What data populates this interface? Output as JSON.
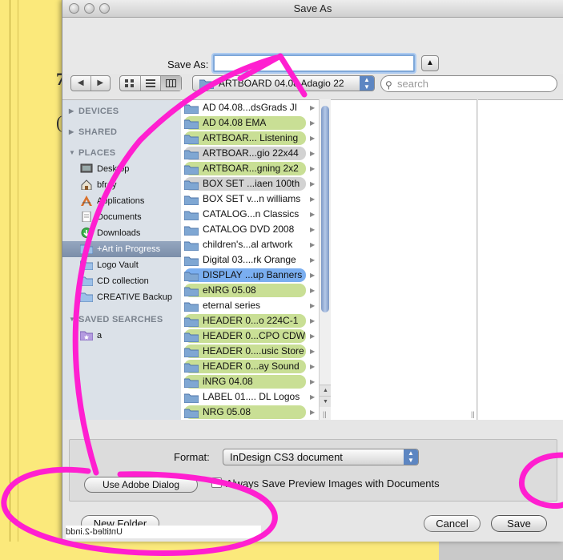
{
  "window": {
    "title": "Save As"
  },
  "save_as": {
    "label": "Save As:",
    "value": "",
    "disclosure_glyph": "▲"
  },
  "toolbar": {
    "back_glyph": "◀",
    "forward_glyph": "▶",
    "views": [
      "icon-view",
      "list-view",
      "column-view"
    ],
    "active_view": "column-view",
    "path_popup": "ARTBOARD 04.08 Adagio 22",
    "search_placeholder": "search"
  },
  "sidebar": {
    "sections": [
      {
        "label": "DEVICES",
        "expanded": false,
        "items": []
      },
      {
        "label": "SHARED",
        "expanded": false,
        "items": []
      },
      {
        "label": "PLACES",
        "expanded": true,
        "items": [
          {
            "label": "Desktop",
            "icon": "desktop-icon"
          },
          {
            "label": "bfrey",
            "icon": "home-icon"
          },
          {
            "label": "Applications",
            "icon": "applications-icon"
          },
          {
            "label": "Documents",
            "icon": "documents-icon"
          },
          {
            "label": "Downloads",
            "icon": "downloads-icon"
          },
          {
            "label": "+Art in Progress",
            "icon": "folder-icon",
            "selected": true
          },
          {
            "label": "Logo Vault",
            "icon": "folder-icon"
          },
          {
            "label": "CD collection",
            "icon": "folder-icon"
          },
          {
            "label": "CREATIVE Backup",
            "icon": "folder-icon"
          }
        ]
      },
      {
        "label": "SAVED SEARCHES",
        "expanded": true,
        "items": [
          {
            "label": "a",
            "icon": "smart-folder-icon"
          }
        ]
      }
    ]
  },
  "column1": [
    {
      "label": "AD 04.08...dsGrads JI",
      "tag": "none"
    },
    {
      "label": "AD 04.08 EMA",
      "tag": "green"
    },
    {
      "label": "ARTBOAR... Listening",
      "tag": "green"
    },
    {
      "label": "ARTBOAR...gio 22x44",
      "tag": "gray"
    },
    {
      "label": "ARTBOAR...gning 2x2",
      "tag": "green"
    },
    {
      "label": "BOX SET ...iaen 100th",
      "tag": "gray"
    },
    {
      "label": "BOX SET v...n williams",
      "tag": "none"
    },
    {
      "label": "CATALOG...n Classics",
      "tag": "none"
    },
    {
      "label": "CATALOG DVD 2008",
      "tag": "none"
    },
    {
      "label": "children's...al artwork",
      "tag": "none"
    },
    {
      "label": "Digital 03....rk Orange",
      "tag": "none"
    },
    {
      "label": "DISPLAY ...up Banners",
      "tag": "blue"
    },
    {
      "label": "eNRG 05.08",
      "tag": "green"
    },
    {
      "label": "eternal series",
      "tag": "none"
    },
    {
      "label": "HEADER 0...o 224C-1",
      "tag": "green"
    },
    {
      "label": "HEADER 0...CPO CDW",
      "tag": "green"
    },
    {
      "label": "HEADER 0....usic Store",
      "tag": "green"
    },
    {
      "label": "HEADER 0...ay Sound",
      "tag": "green"
    },
    {
      "label": "iNRG 04.08",
      "tag": "green"
    },
    {
      "label": "LABEL 01.... DL Logos",
      "tag": "none"
    },
    {
      "label": "NRG 05.08",
      "tag": "green"
    }
  ],
  "options": {
    "format_label": "Format:",
    "format_value": "InDesign CS3 document",
    "adobe_dialog_button": "Use Adobe Dialog",
    "preview_checkbox_label": "Always Save Preview Images with Documents",
    "preview_checked": true
  },
  "buttons": {
    "new_folder": "New Folder",
    "cancel": "Cancel",
    "save": "Save"
  },
  "background": {
    "document_name": "Untitled-2.indd"
  },
  "colors": {
    "background_yellow": "#fbe97b",
    "label_green": "#c9df95",
    "label_gray": "#d2d2d2",
    "label_blue": "#7aaef0",
    "sidebar_selection": "#7b8ea9",
    "annotation_magenta": "#ff1fd0"
  }
}
